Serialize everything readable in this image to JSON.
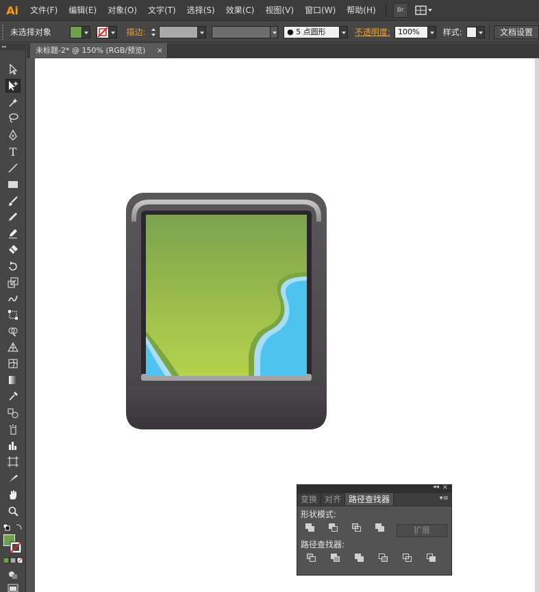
{
  "app": {
    "logo": "Ai",
    "menu": [
      "文件(F)",
      "编辑(E)",
      "对象(O)",
      "文字(T)",
      "选择(S)",
      "效果(C)",
      "视图(V)",
      "窗口(W)",
      "帮助(H)"
    ],
    "bridge_label": "Br"
  },
  "control_bar": {
    "selection_label": "未选择对象",
    "fill_color": "#6fa04a",
    "stroke_label": "描边:",
    "brush_label": "5 点圆形",
    "opacity_label": "不透明度:",
    "opacity_value": "100%",
    "style_label": "样式:",
    "doc_setup_label": "文档设置"
  },
  "document": {
    "tab_title": "未标题-2* @ 150% (RGB/预览)",
    "close_glyph": "×"
  },
  "toolbar": {
    "tools": [
      "selection-tool",
      "direct-selection-tool",
      "magic-wand-tool",
      "lasso-tool",
      "pen-tool",
      "type-tool",
      "line-tool",
      "rectangle-tool",
      "paintbrush-tool",
      "pencil-tool",
      "blob-brush-tool",
      "eraser-tool",
      "rotate-tool",
      "scale-tool",
      "warp-tool",
      "free-transform-tool",
      "shape-builder-tool",
      "perspective-grid-tool",
      "mesh-tool",
      "gradient-tool",
      "eyedropper-tool",
      "blend-tool",
      "symbol-sprayer-tool",
      "column-graph-tool",
      "artboard-tool",
      "slice-tool",
      "hand-tool",
      "zoom-tool"
    ],
    "fill_color": "#6fa04a"
  },
  "artwork": {
    "frame_color": "#4e4b4f",
    "sky_top": "#7aa34e",
    "sky_bottom": "#b6d24b",
    "water_color": "#4fc3f0",
    "shore_color": "#7aa53f",
    "foam_color": "#a9ddf3"
  },
  "pathfinder_panel": {
    "tabs": [
      "变换",
      "对齐",
      "路径查找器"
    ],
    "active_tab": "路径查找器",
    "shape_modes_label": "形状模式:",
    "pathfinders_label": "路径查找器:",
    "expand_label": "扩展",
    "collapse_glyph": "◂◂",
    "close_glyph": "×"
  }
}
